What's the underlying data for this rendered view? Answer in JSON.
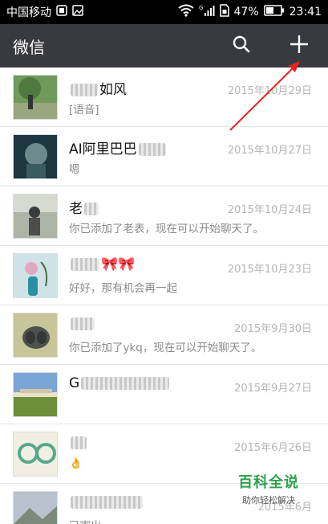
{
  "status_bar": {
    "carrier": "中国移动",
    "battery_percent": "47%",
    "time": "23:41",
    "network_label": "G",
    "icons": [
      "notification-icon",
      "image-icon",
      "wifi-icon",
      "signal-icon",
      "sim-icon",
      "battery-icon"
    ]
  },
  "app_bar": {
    "title": "微信",
    "actions": [
      "search-icon",
      "add-icon"
    ]
  },
  "chats": [
    {
      "name": "如风",
      "preview": "[语音]",
      "time": "2015年10月29日",
      "blurred_prefix": true
    },
    {
      "name": "AI阿里巴巴",
      "preview": "嗯",
      "time": "2015年10月27日",
      "blurred_suffix": true
    },
    {
      "name": "老",
      "preview": "你已添加了老表，现在可以开始聊天了。",
      "time": "2015年10月24日",
      "blurred_suffix": true
    },
    {
      "name": "🎀🎀",
      "preview": "好好，那有机会再一起",
      "time": "2015年10月23日",
      "blurred_prefix": true
    },
    {
      "name": "",
      "preview": "你已添加了ykq，现在可以开始聊天了。",
      "time": "2015年9月30日",
      "blurred_prefix": true
    },
    {
      "name": "G",
      "preview": "",
      "time": "2015年9月27日",
      "blurred_suffix": true
    },
    {
      "name": "",
      "preview": "👌",
      "time": "2015年6月26日",
      "blurred_prefix": true
    },
    {
      "name": "",
      "preview": "已寄出",
      "time": "2015年6月",
      "blurred_prefix": true
    }
  ],
  "watermark": {
    "title": "百科全说",
    "subtitle": "助你轻松解决"
  },
  "colors": {
    "app_bar": "#393a3f",
    "status_bar": "#000000",
    "arrow": "#e8231f",
    "watermark": "#2ba24c"
  }
}
